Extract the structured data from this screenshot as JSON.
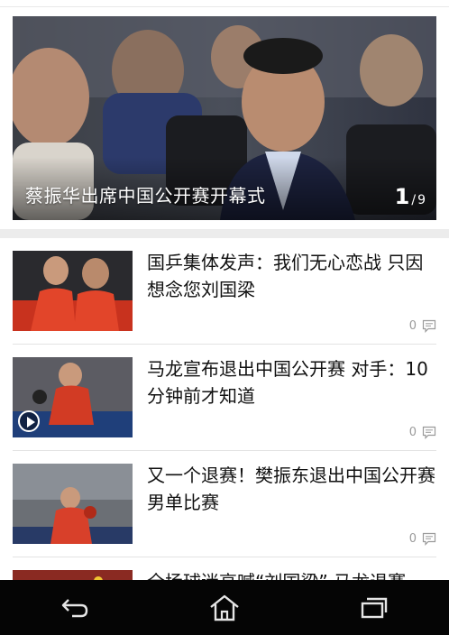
{
  "hero": {
    "title": "蔡振华出席中国公开赛开幕式",
    "counter_current": "1",
    "counter_total": "9"
  },
  "news": [
    {
      "title": "国乒集体发声：我们无心恋战 只因想念您刘国梁",
      "comments": "0",
      "has_video": false
    },
    {
      "title": "马龙宣布退出中国公开赛 对手：10分钟前才知道",
      "comments": "0",
      "has_video": true
    },
    {
      "title": "又一个退赛！樊振东退出中国公开赛男单比赛",
      "comments": "0",
      "has_video": false
    },
    {
      "title": "全场球迷高喊“刘国梁” 马龙退赛",
      "comments": "",
      "has_video": false
    }
  ],
  "icons": {
    "comment": "comment-bubble-icon",
    "back": "back-arrow-icon",
    "home": "home-icon",
    "recents": "recent-apps-icon",
    "play": "play-icon"
  },
  "colors": {
    "nav_bg": "#050505",
    "separator": "#ececec",
    "meta_text": "#9a9a9a"
  }
}
